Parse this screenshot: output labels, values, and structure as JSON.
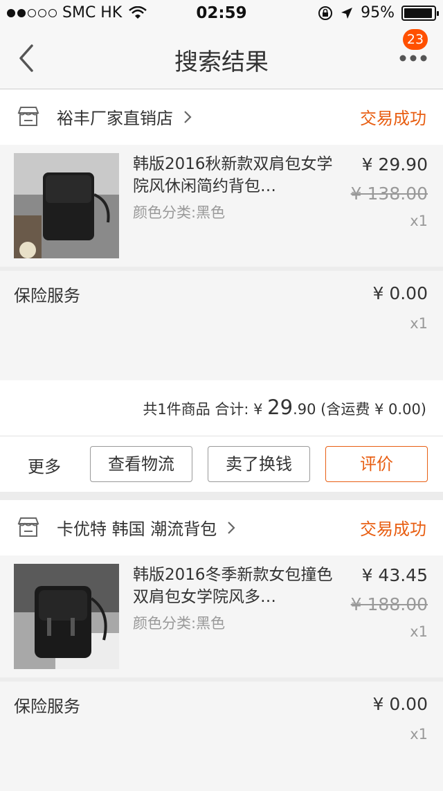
{
  "status_bar": {
    "carrier": "SMC HK",
    "time": "02:59",
    "battery": "95%",
    "battery_level": 0.95
  },
  "nav": {
    "title": "搜索结果",
    "badge": "23"
  },
  "orders": [
    {
      "shop": "裕丰厂家直销店",
      "status": "交易成功",
      "item": {
        "name": "韩版2016秋新款双肩包女学院风休闲简约背包…",
        "sku": "颜色分类:黑色",
        "price": "¥ 29.90",
        "original_price": "¥ 138.00",
        "qty": "x1"
      },
      "insurance": {
        "label": "保险服务",
        "price": "¥ 0.00",
        "qty": "x1"
      },
      "summary": {
        "prefix": "共1件商品 合计: ¥ ",
        "int": "29",
        "dec": ".90",
        "shipping": " (含运费 ¥ 0.00)"
      },
      "actions": {
        "more": "更多",
        "logistics": "查看物流",
        "resell": "卖了换钱",
        "review": "评价"
      }
    },
    {
      "shop": "卡优特 韩国 潮流背包",
      "status": "交易成功",
      "item": {
        "name": "韩版2016冬季新款女包撞色双肩包女学院风多…",
        "sku": "颜色分类:黑色",
        "price": "¥ 43.45",
        "original_price": "¥ 188.00",
        "qty": "x1"
      },
      "insurance": {
        "label": "保险服务",
        "price": "¥ 0.00",
        "qty": "x1"
      }
    }
  ],
  "colors": {
    "accent": "#e85e12",
    "badge": "#ff5000"
  }
}
